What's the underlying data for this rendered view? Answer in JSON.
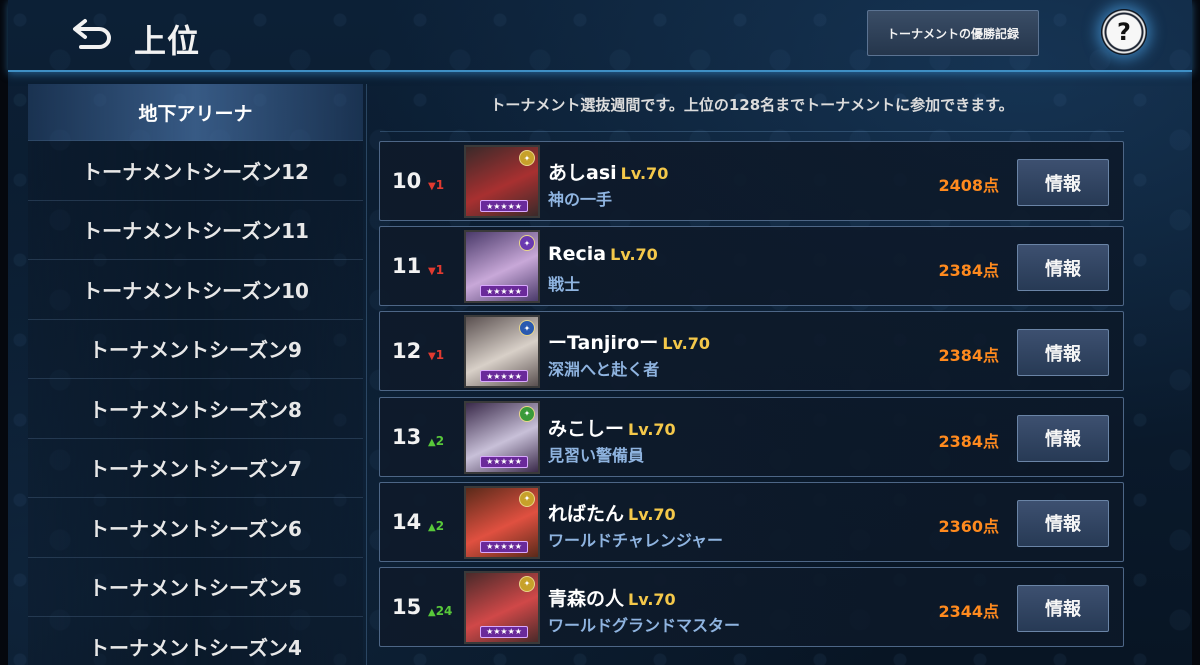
{
  "header": {
    "title": "上位",
    "history_label": "トーナメントの優勝記録",
    "help_symbol": "?"
  },
  "sidebar": {
    "items": [
      {
        "label": "地下アリーナ",
        "active": true
      },
      {
        "label": "トーナメントシーズン12",
        "active": false
      },
      {
        "label": "トーナメントシーズン11",
        "active": false
      },
      {
        "label": "トーナメントシーズン10",
        "active": false
      },
      {
        "label": "トーナメントシーズン9",
        "active": false
      },
      {
        "label": "トーナメントシーズン8",
        "active": false
      },
      {
        "label": "トーナメントシーズン7",
        "active": false
      },
      {
        "label": "トーナメントシーズン6",
        "active": false
      },
      {
        "label": "トーナメントシーズン5",
        "active": false
      },
      {
        "label": "トーナメントシーズン4",
        "active": false
      }
    ]
  },
  "notice": "トーナメント選抜週間です。上位の128名までトーナメントに参加できます。",
  "info_label": "情報",
  "rankings": [
    {
      "rank": "10",
      "trend": "1",
      "direction": "down",
      "name": "あしasi",
      "level": "Lv.70",
      "title": "神の一手",
      "score": "2408点",
      "colors": [
        "#3a2a2a",
        "#a83030"
      ],
      "badge": "#c7a12a"
    },
    {
      "rank": "11",
      "trend": "1",
      "direction": "down",
      "name": "Recia",
      "level": "Lv.70",
      "title": "戦士",
      "score": "2384点",
      "colors": [
        "#4a3a6a",
        "#c8a8d8"
      ],
      "badge": "#6a3ab0"
    },
    {
      "rank": "12",
      "trend": "1",
      "direction": "down",
      "name": "ーTanjiroー",
      "level": "Lv.70",
      "title": "深淵へと赴く者",
      "score": "2384点",
      "colors": [
        "#5a5050",
        "#d8d0c8"
      ],
      "badge": "#2a5ab0"
    },
    {
      "rank": "13",
      "trend": "2",
      "direction": "up",
      "name": "みこしー",
      "level": "Lv.70",
      "title": "見習い警備員",
      "score": "2384点",
      "colors": [
        "#3a2a4a",
        "#c8c0d8"
      ],
      "badge": "#3a9a3a"
    },
    {
      "rank": "14",
      "trend": "2",
      "direction": "up",
      "name": "ればたん",
      "level": "Lv.70",
      "title": "ワールドチャレンジャー",
      "score": "2360点",
      "colors": [
        "#5a2a1a",
        "#e05040"
      ],
      "badge": "#c7a12a"
    },
    {
      "rank": "15",
      "trend": "24",
      "direction": "up",
      "name": "青森の人",
      "level": "Lv.70",
      "title": "ワールドグランドマスター",
      "score": "2344点",
      "colors": [
        "#4a2a2a",
        "#d04848"
      ],
      "badge": "#c7a12a"
    }
  ]
}
